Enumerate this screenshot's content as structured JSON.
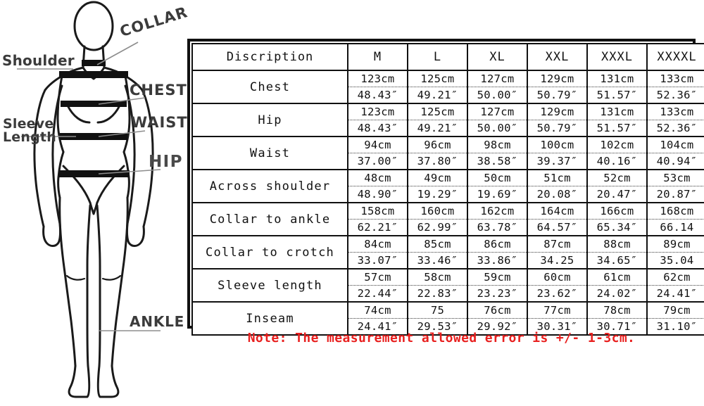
{
  "diagram": {
    "labels": {
      "collar": "COLLAR",
      "shoulder": "Shoulder",
      "chest": "CHEST",
      "waist": "WAIST",
      "sleeve_length": "Sleeve\nLength",
      "hip": "HIP",
      "ankle": "ANKLE"
    },
    "figure_alt": "front-facing human body outline with measurement bands at collar, shoulder, chest, waist and hip"
  },
  "table": {
    "headers": [
      "Discription",
      "M",
      "L",
      "XL",
      "XXL",
      "XXXL",
      "XXXXL"
    ],
    "rows": [
      {
        "label": "Chest",
        "cm": [
          "123cm",
          "125cm",
          "127cm",
          "129cm",
          "131cm",
          "133cm"
        ],
        "inch": [
          "48.43″",
          "49.21″",
          "50.00″",
          "50.79″",
          "51.57″",
          "52.36″"
        ]
      },
      {
        "label": "Hip",
        "cm": [
          "123cm",
          "125cm",
          "127cm",
          "129cm",
          "131cm",
          "133cm"
        ],
        "inch": [
          "48.43″",
          "49.21″",
          "50.00″",
          "50.79″",
          "51.57″",
          "52.36″"
        ]
      },
      {
        "label": "Waist",
        "cm": [
          "94cm",
          "96cm",
          "98cm",
          "100cm",
          "102cm",
          "104cm"
        ],
        "inch": [
          "37.00″",
          "37.80″",
          "38.58″",
          "39.37″",
          "40.16″",
          "40.94″"
        ]
      },
      {
        "label": "Across shoulder",
        "cm": [
          "48cm",
          "49cm",
          "50cm",
          "51cm",
          "52cm",
          "53cm"
        ],
        "inch": [
          "48.90″",
          "19.29″",
          "19.69″",
          "20.08″",
          "20.47″",
          "20.87″"
        ]
      },
      {
        "label": "Collar to ankle",
        "cm": [
          "158cm",
          "160cm",
          "162cm",
          "164cm",
          "166cm",
          "168cm"
        ],
        "inch": [
          "62.21″",
          "62.99″",
          "63.78″",
          "64.57″",
          "65.34″",
          "66.14"
        ]
      },
      {
        "label": "Collar to crotch",
        "cm": [
          "84cm",
          "85cm",
          "86cm",
          "87cm",
          "88cm",
          "89cm"
        ],
        "inch": [
          "33.07″",
          "33.46″",
          "33.86″",
          "34.25",
          "34.65″",
          "35.04"
        ]
      },
      {
        "label": "Sleeve length",
        "cm": [
          "57cm",
          "58cm",
          "59cm",
          "60cm",
          "61cm",
          "62cm"
        ],
        "inch": [
          "22.44″",
          "22.83″",
          "23.23″",
          "23.62″",
          "24.02″",
          "24.41″"
        ]
      },
      {
        "label": "Inseam",
        "cm": [
          "74cm",
          "75",
          "76cm",
          "77cm",
          "78cm",
          "79cm"
        ],
        "inch": [
          "24.41″",
          "29.53″",
          "29.92″",
          "30.31″",
          "30.71″",
          "31.10″"
        ]
      }
    ]
  },
  "note": {
    "text": "Note: The measurement allowed error is +/- 1-3cm.",
    "color": "#e8201f"
  },
  "colors": {
    "table_border": "#111111",
    "text": "#111111",
    "label_text": "#3b3b3b",
    "background": "#ffffff"
  }
}
